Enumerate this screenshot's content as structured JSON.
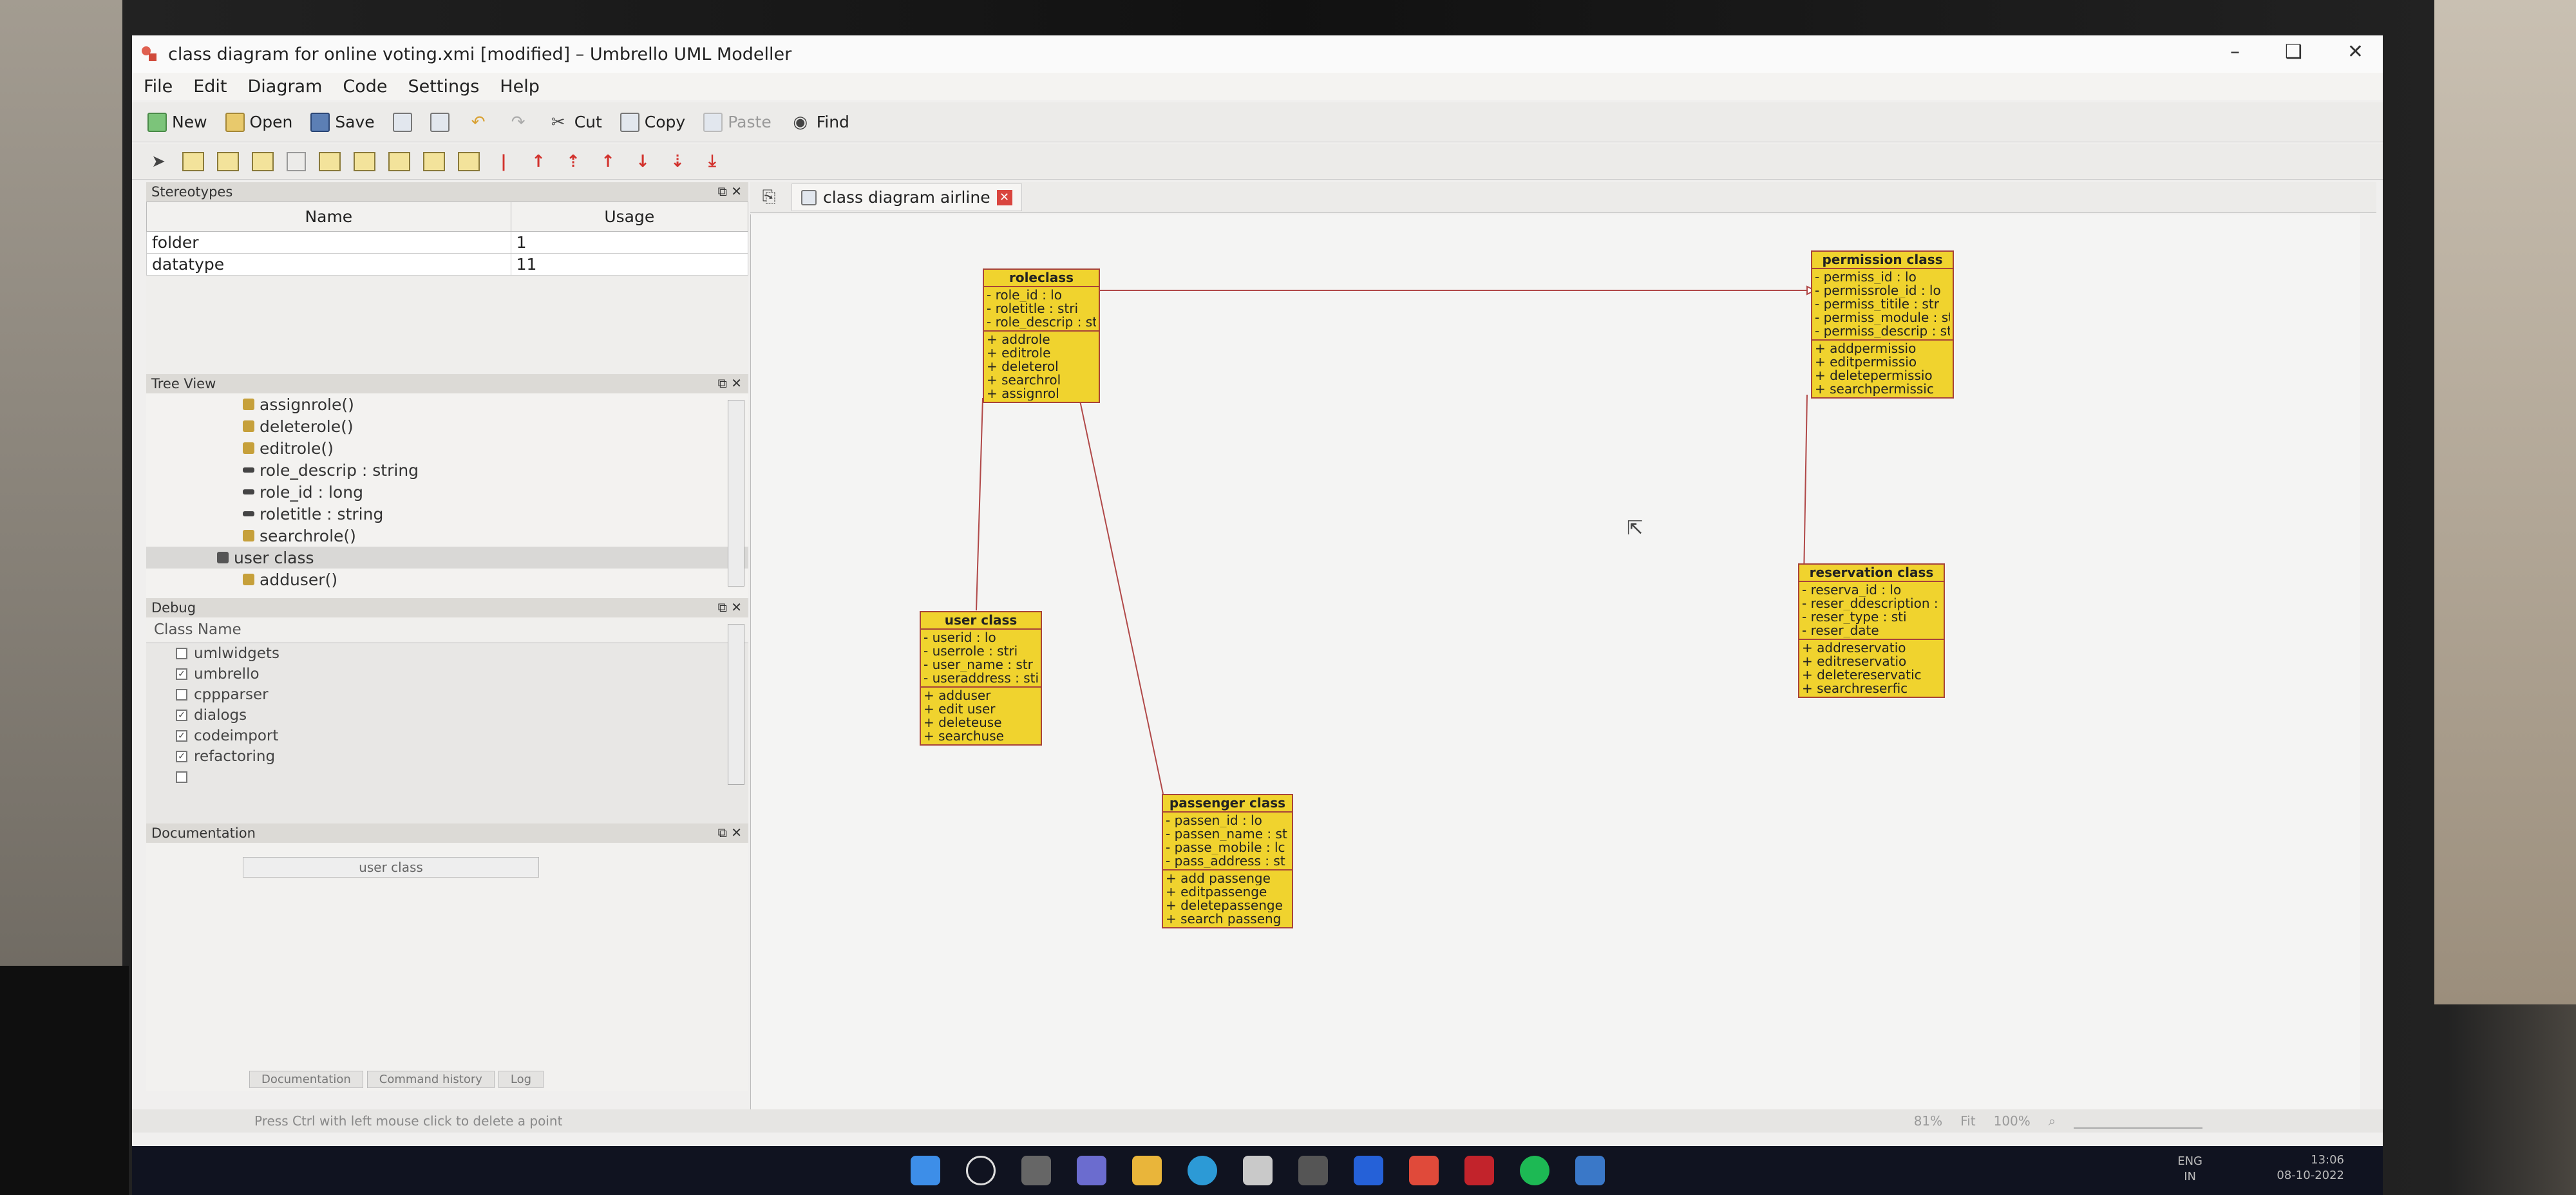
{
  "window": {
    "title": "class diagram for online voting.xmi [modified] – Umbrello UML Modeller",
    "controls": [
      "–",
      "❑",
      "✕"
    ]
  },
  "menu": [
    "File",
    "Edit",
    "Diagram",
    "Code",
    "Settings",
    "Help"
  ],
  "toolbar": {
    "new": "New",
    "open": "Open",
    "save": "Save",
    "cut": "Cut",
    "copy": "Copy",
    "paste": "Paste",
    "find": "Find"
  },
  "panels": {
    "stereotypes": {
      "title": "Stereotypes",
      "headers": [
        "Name",
        "Usage"
      ],
      "rows": [
        {
          "name": "folder",
          "usage": "1"
        },
        {
          "name": "datatype",
          "usage": "11"
        }
      ]
    },
    "tree": {
      "title": "Tree View",
      "items": [
        "assignrole()",
        "deleterole()",
        "editrole()",
        "role_descrip : string",
        "role_id : long",
        "roletitle : string",
        "searchrole()",
        "user class",
        "adduser()"
      ]
    },
    "debug": {
      "title": "Debug",
      "header": "Class Name",
      "rows": [
        "umlwidgets",
        "umbrello",
        "cppparser",
        "dialogs",
        "codeimport",
        "refactoring",
        ""
      ]
    },
    "documentation": {
      "title": "Documentation",
      "field": "user class",
      "tabs": [
        "Documentation",
        "Command history",
        "Log"
      ]
    }
  },
  "diagram": {
    "tab_label": "class diagram airline",
    "classes": {
      "roleclass": {
        "name": "roleclass",
        "attrs": [
          "- role_id : lo",
          "- roletitle : stri",
          "- role_descrip : sti"
        ],
        "ops": [
          "+ addrole",
          "+ editrole",
          "+ deleterol",
          "+ searchrol",
          "+ assignrol"
        ]
      },
      "permission": {
        "name": "permission class",
        "attrs": [
          "- permiss_id : lo",
          "- permissrole_id : lo",
          "- permiss_titile : str",
          "- permiss_module : st",
          "- permiss_descrip : st"
        ],
        "ops": [
          "+ addpermissio",
          "+ editpermissio",
          "+ deletepermissio",
          "+ searchpermissic"
        ]
      },
      "user": {
        "name": "user class",
        "attrs": [
          "- userid : lo",
          "- userrole : stri",
          "- user_name : str",
          "- useraddress : sti"
        ],
        "ops": [
          "+ adduser",
          "+ edit user",
          "+ deleteuse",
          "+ searchuse"
        ]
      },
      "reservation": {
        "name": "reservation class",
        "attrs": [
          "- reserva_id : lo",
          "- reser_ddescription : s",
          "- reser_type : sti",
          "- reser_date"
        ],
        "ops": [
          "+ addreservatio",
          "+ editreservatio",
          "+ deletereservatic",
          "+ searchreserfic"
        ]
      },
      "passenger": {
        "name": "passenger class",
        "attrs": [
          "- passen_id : lo",
          "- passen_name : st",
          "- passe_mobile : lc",
          "- pass_address : st"
        ],
        "ops": [
          "+ add passenge",
          "+ editpassenge",
          "+ deletepassenge",
          "+ search passeng"
        ]
      }
    }
  },
  "status": {
    "message": "Press Ctrl with left mouse click to delete a point",
    "zoom": "81%",
    "fit": "Fit",
    "hundred": "100%"
  },
  "taskbar": {
    "lang": [
      "ENG",
      "IN"
    ],
    "time": "13:06",
    "date": "08-10-2022"
  },
  "colors": {
    "class_fill": "#f0d32e",
    "class_border": "#a8443a",
    "association": "#b04848"
  }
}
